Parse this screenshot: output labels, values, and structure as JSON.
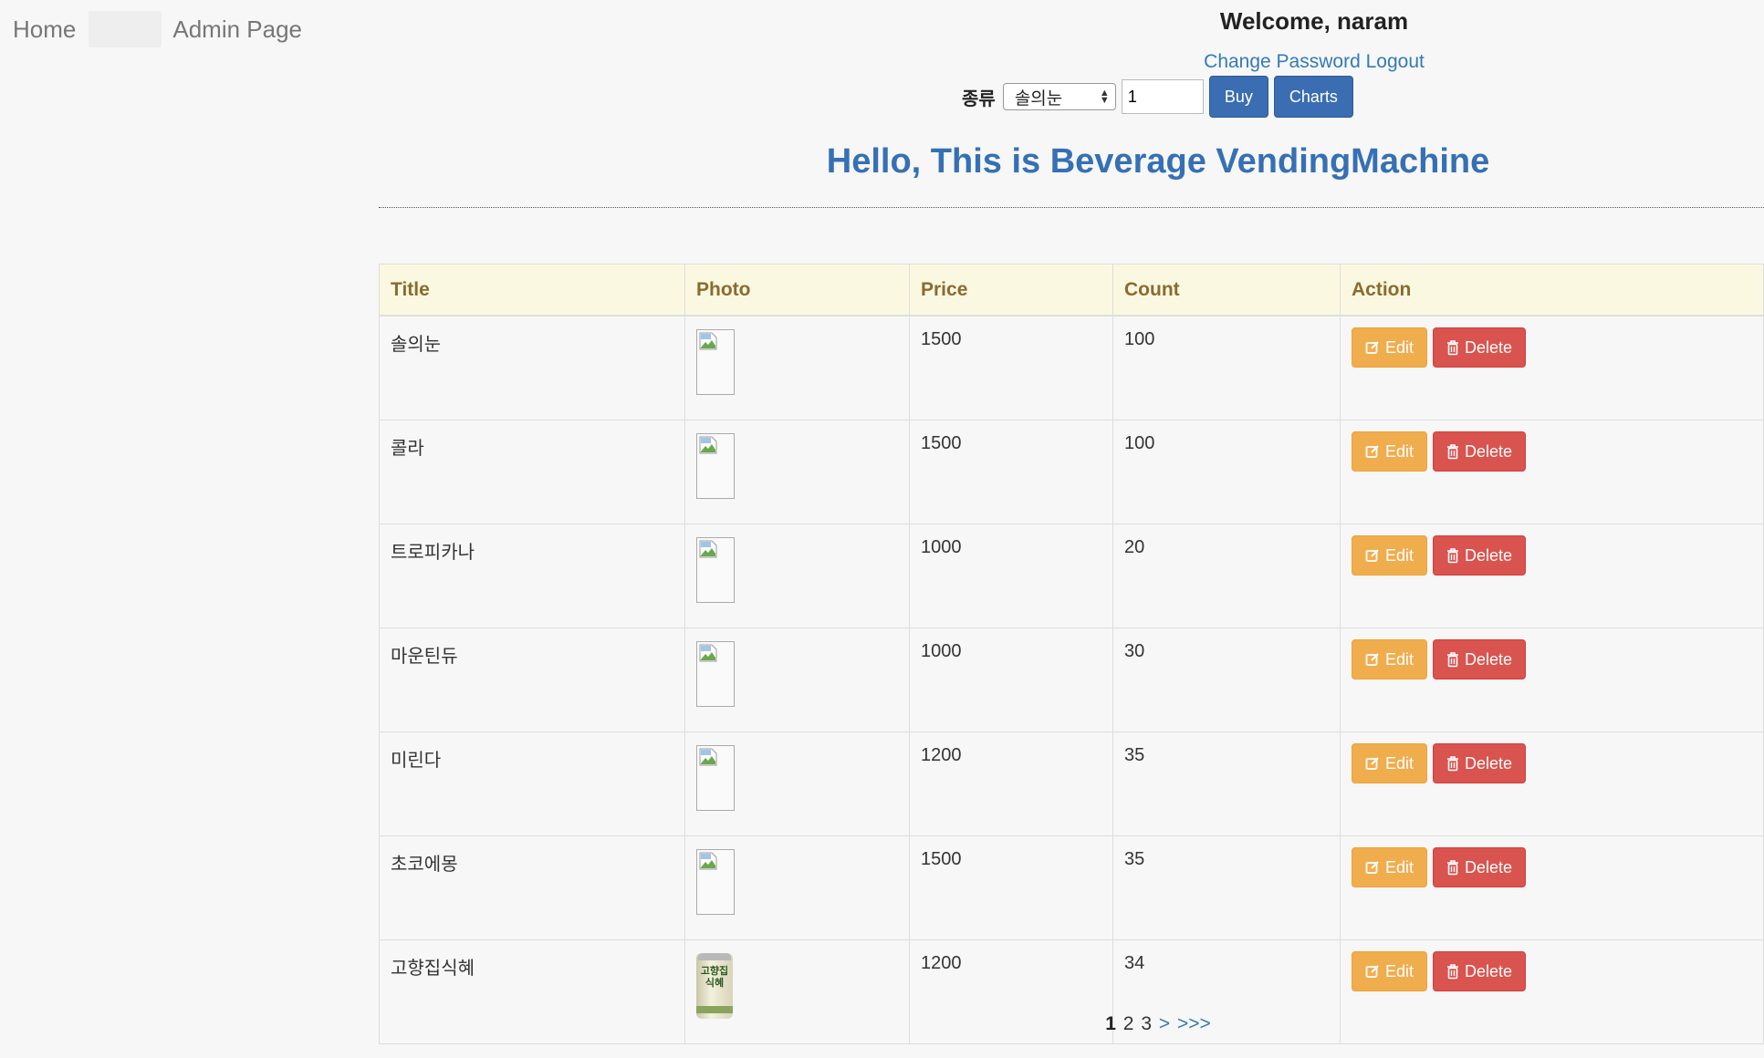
{
  "nav": {
    "home": "Home",
    "admin": "Admin Page"
  },
  "header": {
    "welcome": "Welcome, naram",
    "change_password": "Change Password",
    "logout": "Logout"
  },
  "buy_form": {
    "type_label": "종류",
    "selected_type": "솔의눈",
    "quantity": "1",
    "buy_label": "Buy",
    "charts_label": "Charts"
  },
  "hero_title": "Hello, This is Beverage VendingMachine",
  "table": {
    "columns": [
      "Title",
      "Photo",
      "Price",
      "Count",
      "Action"
    ],
    "edit_label": "Edit",
    "delete_label": "Delete",
    "rows": [
      {
        "title": "솔의눈",
        "price": "1500",
        "count": "100",
        "photo": "broken-image"
      },
      {
        "title": "콜라",
        "price": "1500",
        "count": "100",
        "photo": "broken-image"
      },
      {
        "title": "트로피카나",
        "price": "1000",
        "count": "20",
        "photo": "broken-image"
      },
      {
        "title": "마운틴듀",
        "price": "1000",
        "count": "30",
        "photo": "broken-image"
      },
      {
        "title": "미린다",
        "price": "1200",
        "count": "35",
        "photo": "broken-image"
      },
      {
        "title": "초코에몽",
        "price": "1500",
        "count": "35",
        "photo": "broken-image"
      },
      {
        "title": "고향집식혜",
        "price": "1200",
        "count": "34",
        "photo": "sikhye-can",
        "photo_text": "고향집 식혜"
      }
    ]
  },
  "pagination": {
    "current": "1",
    "pages": [
      "2",
      "3"
    ],
    "next": ">",
    "last": ">>>"
  },
  "colors": {
    "primary": "#3a6db1",
    "edit": "#f0ad4e",
    "delete": "#d9534f",
    "header_bg": "#fbf8e1",
    "title": "#3670b4"
  }
}
